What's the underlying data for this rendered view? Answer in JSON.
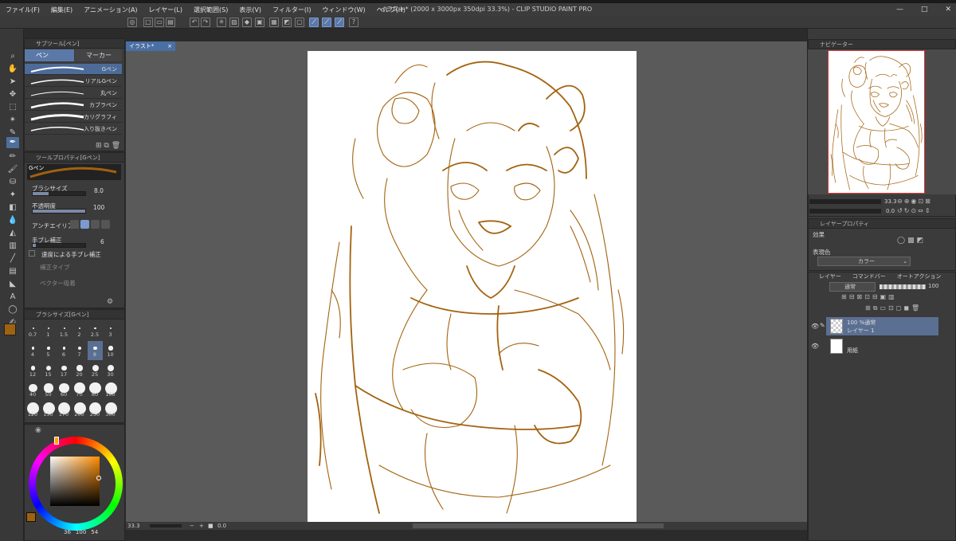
{
  "window": {
    "title": "イラスト* (2000 x 3000px 350dpi 33.3%) - CLIP STUDIO PAINT PRO",
    "controls": {
      "minimize": "—",
      "maximize": "□",
      "close": "✕"
    }
  },
  "menu": [
    "ファイル(F)",
    "編集(E)",
    "アニメーション(A)",
    "レイヤー(L)",
    "選択範囲(S)",
    "表示(V)",
    "フィルター(I)",
    "ウィンドウ(W)",
    "ヘルプ(H)"
  ],
  "subtool_panel": {
    "title": "サブツール[ペン]",
    "tabs": [
      "ペン",
      "マーカー"
    ],
    "brushes": [
      "Gペン",
      "リアルGペン",
      "丸ペン",
      "カブラペン",
      "カリグラフィ",
      "入り抜きペン"
    ]
  },
  "tool_property": {
    "title": "ツールプロパティ[Gペン]",
    "brush_name": "Gペン",
    "brush_size_label": "ブラシサイズ",
    "brush_size_value": "8.0",
    "brush_size_level": 0.3,
    "opacity_label": "不透明度",
    "opacity_value": "100",
    "opacity_level": 1.0,
    "antialias_label": "アンチエイリアス",
    "stabilization_label": "手ブレ補正",
    "stabilization_value": "6",
    "stabilization_level": 0.06,
    "speed_stab_label": "速度による手ブレ補正",
    "correction_type_label": "補正タイプ",
    "vector_snap_label": "ベクター吸着"
  },
  "brush_size_panel": {
    "title": "ブラシサイズ[Gペン]",
    "sizes": [
      "0.7",
      "1",
      "1.5",
      "2",
      "2.5",
      "3",
      "4",
      "5",
      "6",
      "7",
      "8",
      "10",
      "12",
      "15",
      "17",
      "20",
      "25",
      "30",
      "40",
      "50",
      "60",
      "70",
      "80",
      "100",
      "120",
      "150",
      "170",
      "200",
      "250",
      "300"
    ],
    "selected": "8"
  },
  "color_panel": {
    "readout": [
      "36",
      "100",
      "54"
    ],
    "main_color": "#a0620f",
    "sub_color": "#1e3a5c"
  },
  "canvas": {
    "tab_label": "イラスト*",
    "line_color": "#a3630f",
    "status_zoom": "33.3",
    "status_angle": "0.0"
  },
  "navigator": {
    "title": "ナビゲーター",
    "zoom": "33.3",
    "angle": "0.0"
  },
  "layer_property": {
    "title": "レイヤープロパティ",
    "effect_label": "効果",
    "expression_color_label": "表現色",
    "expression_color_value": "カラー"
  },
  "layer_panel": {
    "tabs": [
      "レイヤー",
      "コマンドバー",
      "オートアクション"
    ],
    "blend_mode": "通常",
    "opacity": "100",
    "layers": [
      {
        "line1": "100 %通常",
        "line2": "レイヤー 1"
      },
      {
        "line1": "",
        "line2": "用紙"
      }
    ]
  }
}
